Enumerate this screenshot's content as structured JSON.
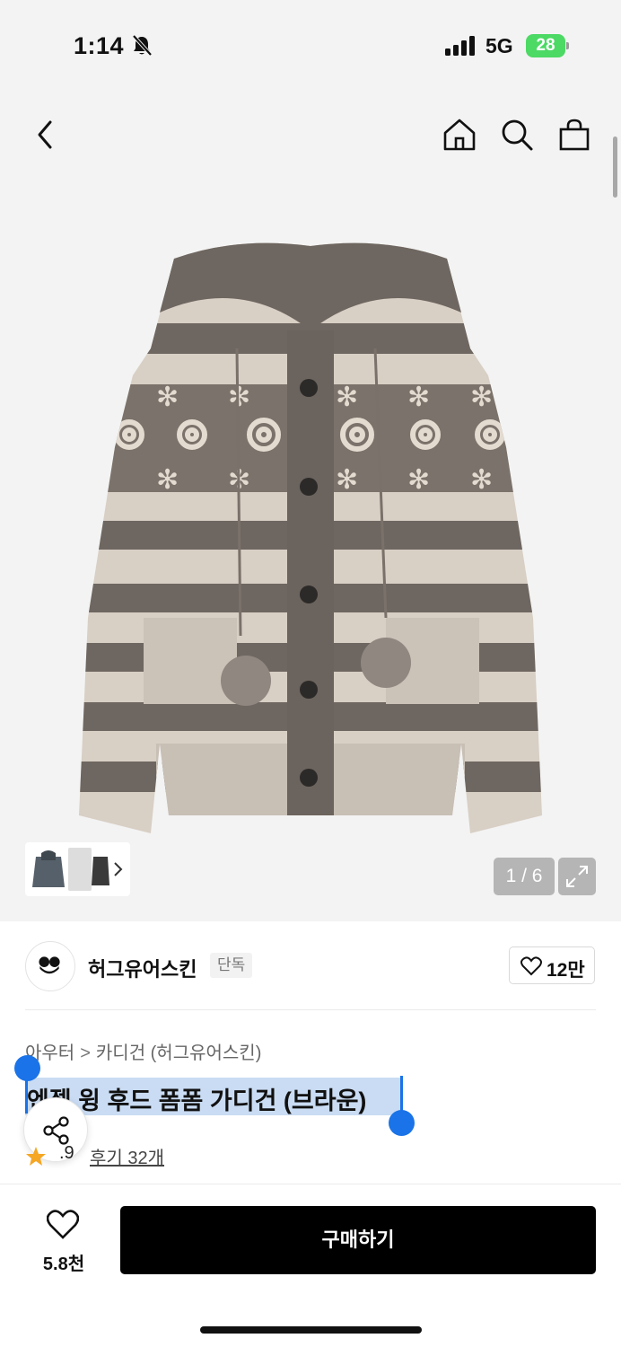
{
  "status_bar": {
    "time": "1:14",
    "network": "5G",
    "battery": "28"
  },
  "nav": {
    "back_icon": "chevron-left-icon",
    "home_icon": "home-icon",
    "search_icon": "search-icon",
    "cart_icon": "shopping-bag-icon"
  },
  "gallery": {
    "page_counter": "1 / 6",
    "current_page": 1,
    "total_pages": 6
  },
  "brand": {
    "name": "허그유어스킨",
    "badge": "단독",
    "like_count": "12만"
  },
  "breadcrumb": {
    "items": [
      "아우터",
      "카디건 (허그유어스킨)"
    ],
    "separator": ">"
  },
  "product": {
    "title": "엔젤 윙 후드 폼폼 가디건 (브라운)",
    "rating": ".9",
    "review_link": "후기 32개"
  },
  "bottom_bar": {
    "wish_count": "5.8천",
    "buy_label": "구매하기"
  },
  "colors": {
    "selection": "#c9dcf3",
    "selection_handle": "#1a73e8",
    "battery": "#4cd964",
    "star": "#f5a623",
    "buy_button": "#000000"
  }
}
